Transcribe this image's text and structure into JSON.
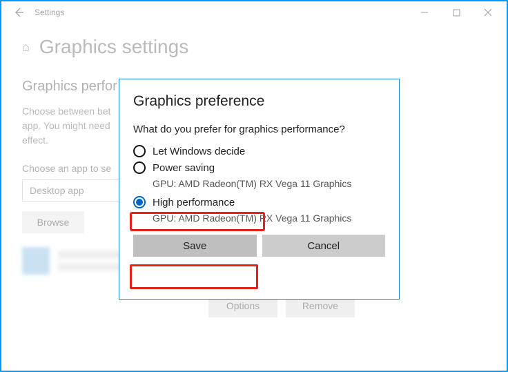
{
  "window": {
    "title": "Settings"
  },
  "page": {
    "title": "Graphics settings",
    "section_title": "Graphics perfor",
    "description": "Choose between bet\napp. You might need\neffect.",
    "choose_label": "Choose an app to se",
    "dropdown_value": "Desktop app",
    "browse_label": "Browse",
    "options_label": "Options",
    "remove_label": "Remove"
  },
  "modal": {
    "title": "Graphics preference",
    "question": "What do you prefer for graphics performance?",
    "options": [
      {
        "label": "Let Windows decide",
        "detail": "",
        "selected": false
      },
      {
        "label": "Power saving",
        "detail": "GPU: AMD Radeon(TM) RX Vega 11 Graphics",
        "selected": false
      },
      {
        "label": "High performance",
        "detail": "GPU: AMD Radeon(TM) RX Vega 11 Graphics",
        "selected": true
      }
    ],
    "save_label": "Save",
    "cancel_label": "Cancel"
  }
}
